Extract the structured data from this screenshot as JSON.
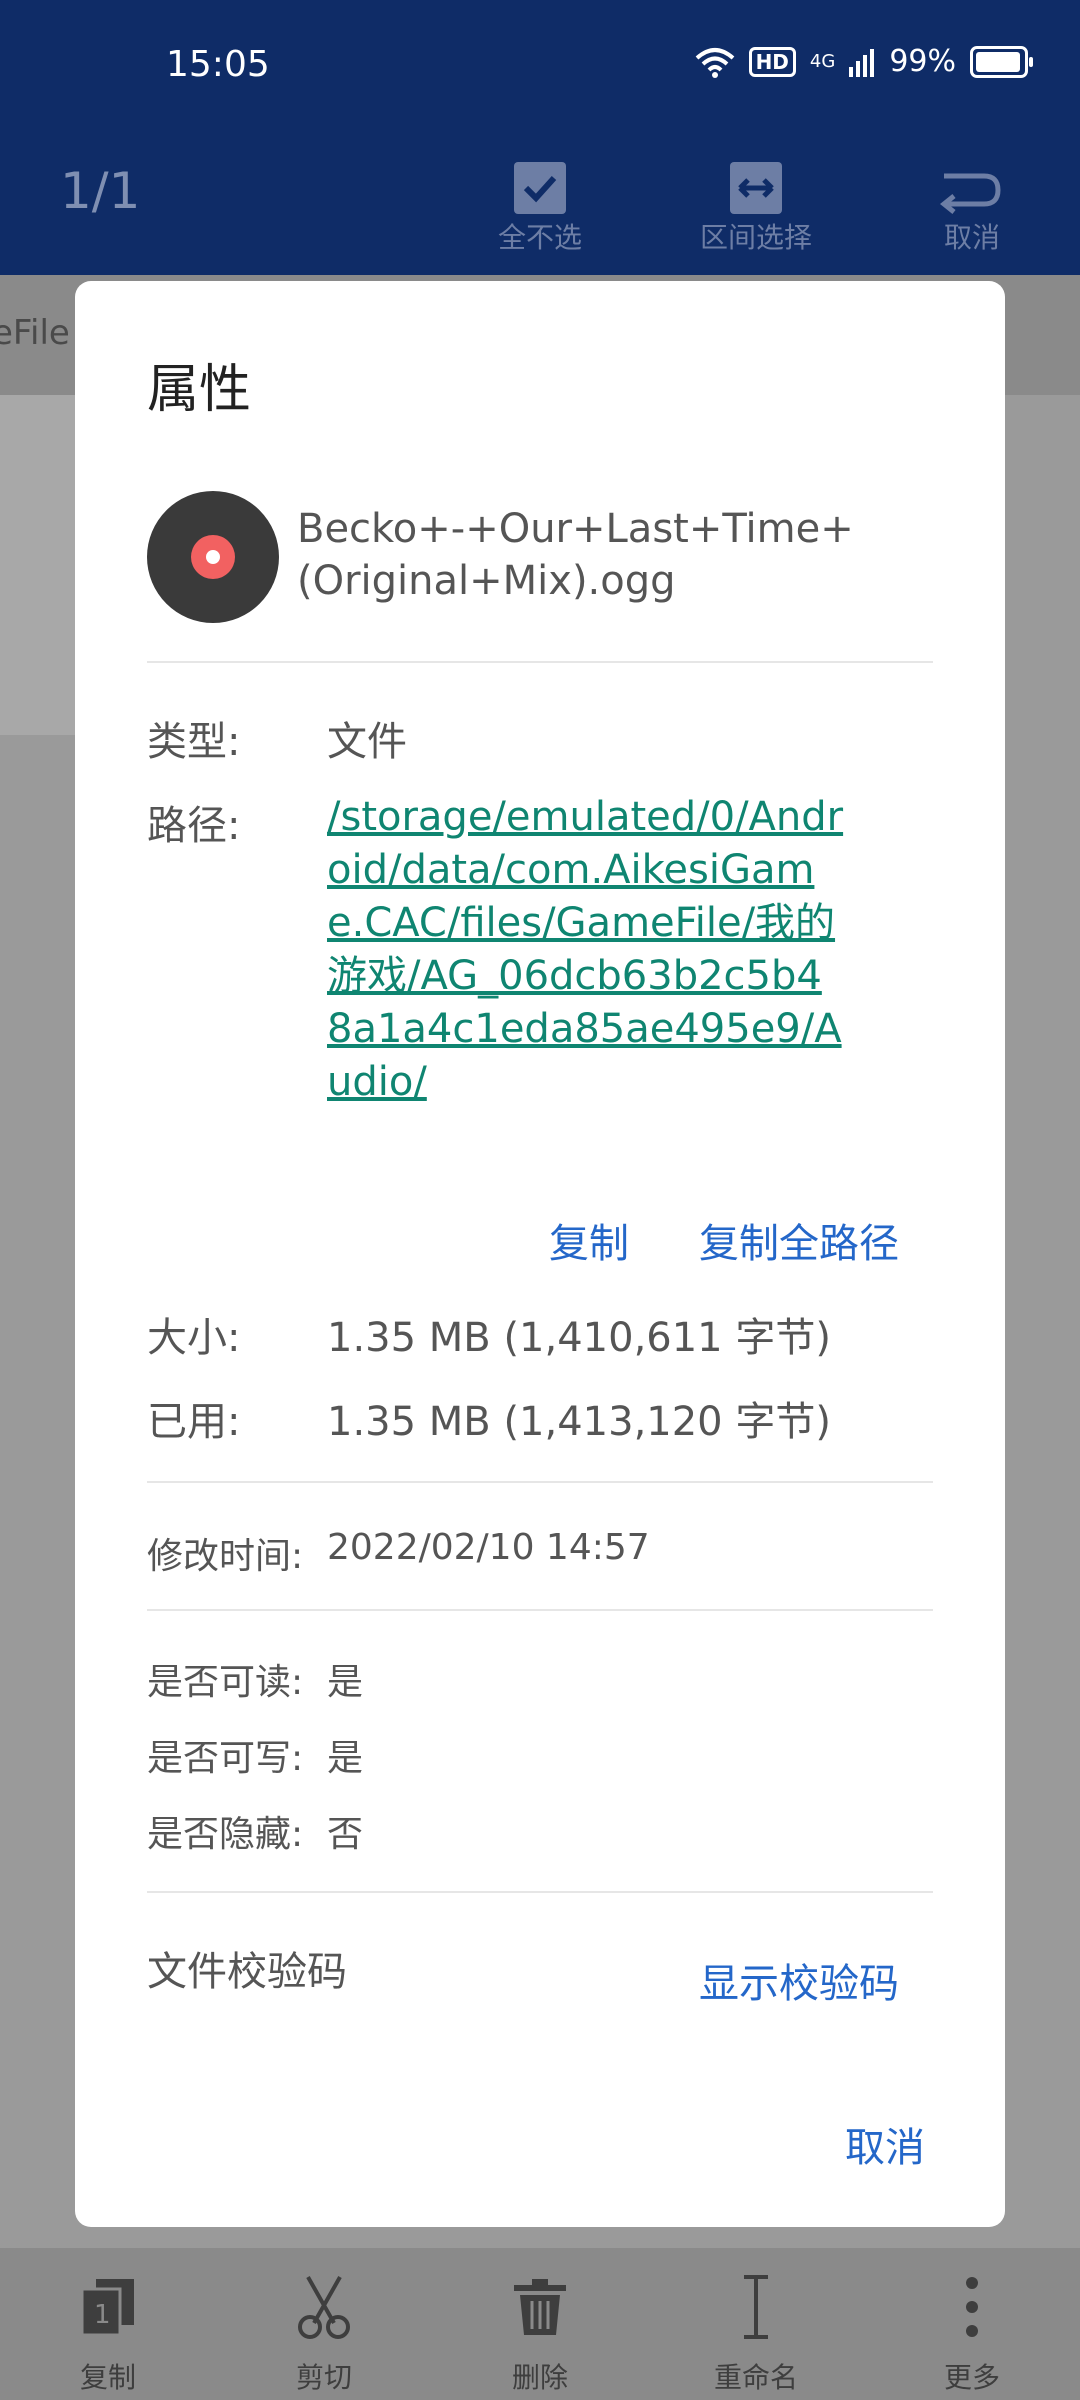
{
  "status": {
    "time": "15:05",
    "hd": "HD",
    "network": "4G",
    "battery": "99%"
  },
  "appbar": {
    "counter": "1/1",
    "actions": [
      {
        "label": "全不选",
        "icon": "checkbox-icon"
      },
      {
        "label": "区间选择",
        "icon": "range-select-icon"
      },
      {
        "label": "取消",
        "icon": "undo-arrow-icon"
      }
    ]
  },
  "background": {
    "path_fragment": "eFile"
  },
  "dialog": {
    "title": "属性",
    "file_name": "Becko+-+Our+Last+Time+(Original+Mix).ogg",
    "type_label": "类型:",
    "type_value": "文件",
    "path_label": "路径:",
    "path_value": "/storage/emulated/0/Android/data/com.AikesiGame.CAC/files/GameFile/我的游戏/AG_06dcb63b2c5b48a1a4c1eda85ae495e9/Audio/",
    "copy_label": "复制",
    "copy_full_path_label": "复制全路径",
    "size_label": "大小:",
    "size_value": "1.35 MB (1,410,611 字节)",
    "used_label": "已用:",
    "used_value": "1.35 MB (1,413,120 字节)",
    "modified_label": "修改时间:",
    "modified_value": "2022/02/10 14:57",
    "readable_label": "是否可读:",
    "readable_value": "是",
    "writable_label": "是否可写:",
    "writable_value": "是",
    "hidden_label": "是否隐藏:",
    "hidden_value": "否",
    "checksum_label": "文件校验码",
    "show_checksum_label": "显示校验码",
    "cancel_label": "取消"
  },
  "bottombar": {
    "actions": [
      {
        "label": "复制",
        "icon": "copy-icon"
      },
      {
        "label": "剪切",
        "icon": "scissors-icon"
      },
      {
        "label": "删除",
        "icon": "trash-icon"
      },
      {
        "label": "重命名",
        "icon": "rename-icon"
      },
      {
        "label": "更多",
        "icon": "more-vertical-icon"
      }
    ]
  }
}
